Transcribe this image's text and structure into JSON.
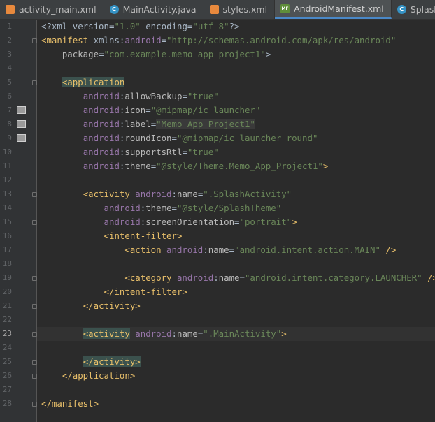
{
  "tabs": [
    {
      "name": "activity_main.xml",
      "icon": "xml-file-icon",
      "active": false
    },
    {
      "name": "MainActivity.java",
      "icon": "java-class-icon",
      "active": false
    },
    {
      "name": "styles.xml",
      "icon": "xml-file-icon",
      "active": false
    },
    {
      "name": "AndroidManifest.xml",
      "icon": "manifest-file-icon",
      "active": true
    },
    {
      "name": "SplashActivity.java",
      "icon": "java-class-icon",
      "active": false
    }
  ],
  "editor": {
    "current_line": 23,
    "image_gutter_lines": [
      7,
      8,
      9
    ],
    "fold_lines": [
      2,
      5,
      13,
      15,
      19,
      21,
      23,
      25,
      26,
      28
    ],
    "highlight_lines": [
      5,
      23,
      25
    ],
    "lines": [
      [
        [
          "t",
          "<?"
        ],
        [
          "t",
          "xml version="
        ],
        [
          "v",
          "\"1.0\""
        ],
        [
          "t",
          " encoding="
        ],
        [
          "v",
          "\"utf-8\""
        ],
        [
          "t",
          "?>"
        ]
      ],
      [
        [
          "g",
          "<manifest"
        ],
        [
          "t",
          " xmlns:"
        ],
        [
          "p",
          "android"
        ],
        [
          "t",
          "="
        ],
        [
          "v",
          "\"http://schemas.android.com/apk/res/android\""
        ]
      ],
      [
        [
          "t",
          "    "
        ],
        [
          "a",
          "package"
        ],
        [
          "t",
          "="
        ],
        [
          "v",
          "\"com.example.memo_app_project1\""
        ],
        [
          "t",
          ">"
        ]
      ],
      [],
      [
        [
          "t",
          "    "
        ],
        [
          "h",
          "<application"
        ]
      ],
      [
        [
          "t",
          "        "
        ],
        [
          "p",
          "android"
        ],
        [
          "t",
          ":"
        ],
        [
          "a",
          "allowBackup"
        ],
        [
          "t",
          "="
        ],
        [
          "v",
          "\"true\""
        ]
      ],
      [
        [
          "t",
          "        "
        ],
        [
          "p",
          "android"
        ],
        [
          "t",
          ":"
        ],
        [
          "a",
          "icon"
        ],
        [
          "t",
          "="
        ],
        [
          "v",
          "\"@mipmap/ic_launcher\""
        ]
      ],
      [
        [
          "t",
          "        "
        ],
        [
          "p",
          "android"
        ],
        [
          "t",
          ":"
        ],
        [
          "a",
          "label"
        ],
        [
          "t",
          "="
        ],
        [
          "f",
          "\"Memo_App_Project1\""
        ]
      ],
      [
        [
          "t",
          "        "
        ],
        [
          "p",
          "android"
        ],
        [
          "t",
          ":"
        ],
        [
          "a",
          "roundIcon"
        ],
        [
          "t",
          "="
        ],
        [
          "v",
          "\"@mipmap/ic_launcher_round\""
        ]
      ],
      [
        [
          "t",
          "        "
        ],
        [
          "p",
          "android"
        ],
        [
          "t",
          ":"
        ],
        [
          "a",
          "supportsRtl"
        ],
        [
          "t",
          "="
        ],
        [
          "v",
          "\"true\""
        ]
      ],
      [
        [
          "t",
          "        "
        ],
        [
          "p",
          "android"
        ],
        [
          "t",
          ":"
        ],
        [
          "a",
          "theme"
        ],
        [
          "t",
          "="
        ],
        [
          "v",
          "\"@style/Theme.Memo_App_Project1\""
        ],
        [
          "g",
          ">"
        ]
      ],
      [],
      [
        [
          "t",
          "        "
        ],
        [
          "g",
          "<activity"
        ],
        [
          "t",
          " "
        ],
        [
          "p",
          "android"
        ],
        [
          "t",
          ":"
        ],
        [
          "a",
          "name"
        ],
        [
          "t",
          "="
        ],
        [
          "v",
          "\".SplashActivity\""
        ]
      ],
      [
        [
          "t",
          "            "
        ],
        [
          "p",
          "android"
        ],
        [
          "t",
          ":"
        ],
        [
          "a",
          "theme"
        ],
        [
          "t",
          "="
        ],
        [
          "v",
          "\"@style/SplashTheme\""
        ]
      ],
      [
        [
          "t",
          "            "
        ],
        [
          "p",
          "android"
        ],
        [
          "t",
          ":"
        ],
        [
          "a",
          "screenOrientation"
        ],
        [
          "t",
          "="
        ],
        [
          "v",
          "\"portrait\""
        ],
        [
          "g",
          ">"
        ]
      ],
      [
        [
          "t",
          "            "
        ],
        [
          "g",
          "<intent-filter>"
        ]
      ],
      [
        [
          "t",
          "                "
        ],
        [
          "g",
          "<action"
        ],
        [
          "t",
          " "
        ],
        [
          "p",
          "android"
        ],
        [
          "t",
          ":"
        ],
        [
          "a",
          "name"
        ],
        [
          "t",
          "="
        ],
        [
          "v",
          "\"android.intent.action.MAIN\""
        ],
        [
          "g",
          " />"
        ]
      ],
      [],
      [
        [
          "t",
          "                "
        ],
        [
          "g",
          "<category"
        ],
        [
          "t",
          " "
        ],
        [
          "p",
          "android"
        ],
        [
          "t",
          ":"
        ],
        [
          "a",
          "name"
        ],
        [
          "t",
          "="
        ],
        [
          "v",
          "\"android.intent.category.LAUNCHER\""
        ],
        [
          "g",
          " />"
        ]
      ],
      [
        [
          "t",
          "            "
        ],
        [
          "g",
          "</intent-filter>"
        ]
      ],
      [
        [
          "t",
          "        "
        ],
        [
          "g",
          "</activity>"
        ]
      ],
      [],
      [
        [
          "t",
          "        "
        ],
        [
          "h",
          "<activity"
        ],
        [
          "t",
          " "
        ],
        [
          "p",
          "android"
        ],
        [
          "t",
          ":"
        ],
        [
          "a",
          "name"
        ],
        [
          "t",
          "="
        ],
        [
          "v",
          "\".MainActivity\""
        ],
        [
          "g",
          ">"
        ]
      ],
      [],
      [
        [
          "t",
          "        "
        ],
        [
          "h",
          "</activity>"
        ]
      ],
      [
        [
          "t",
          "    "
        ],
        [
          "g",
          "</application>"
        ]
      ],
      [],
      [
        [
          "g",
          "</manifest>"
        ]
      ]
    ]
  }
}
